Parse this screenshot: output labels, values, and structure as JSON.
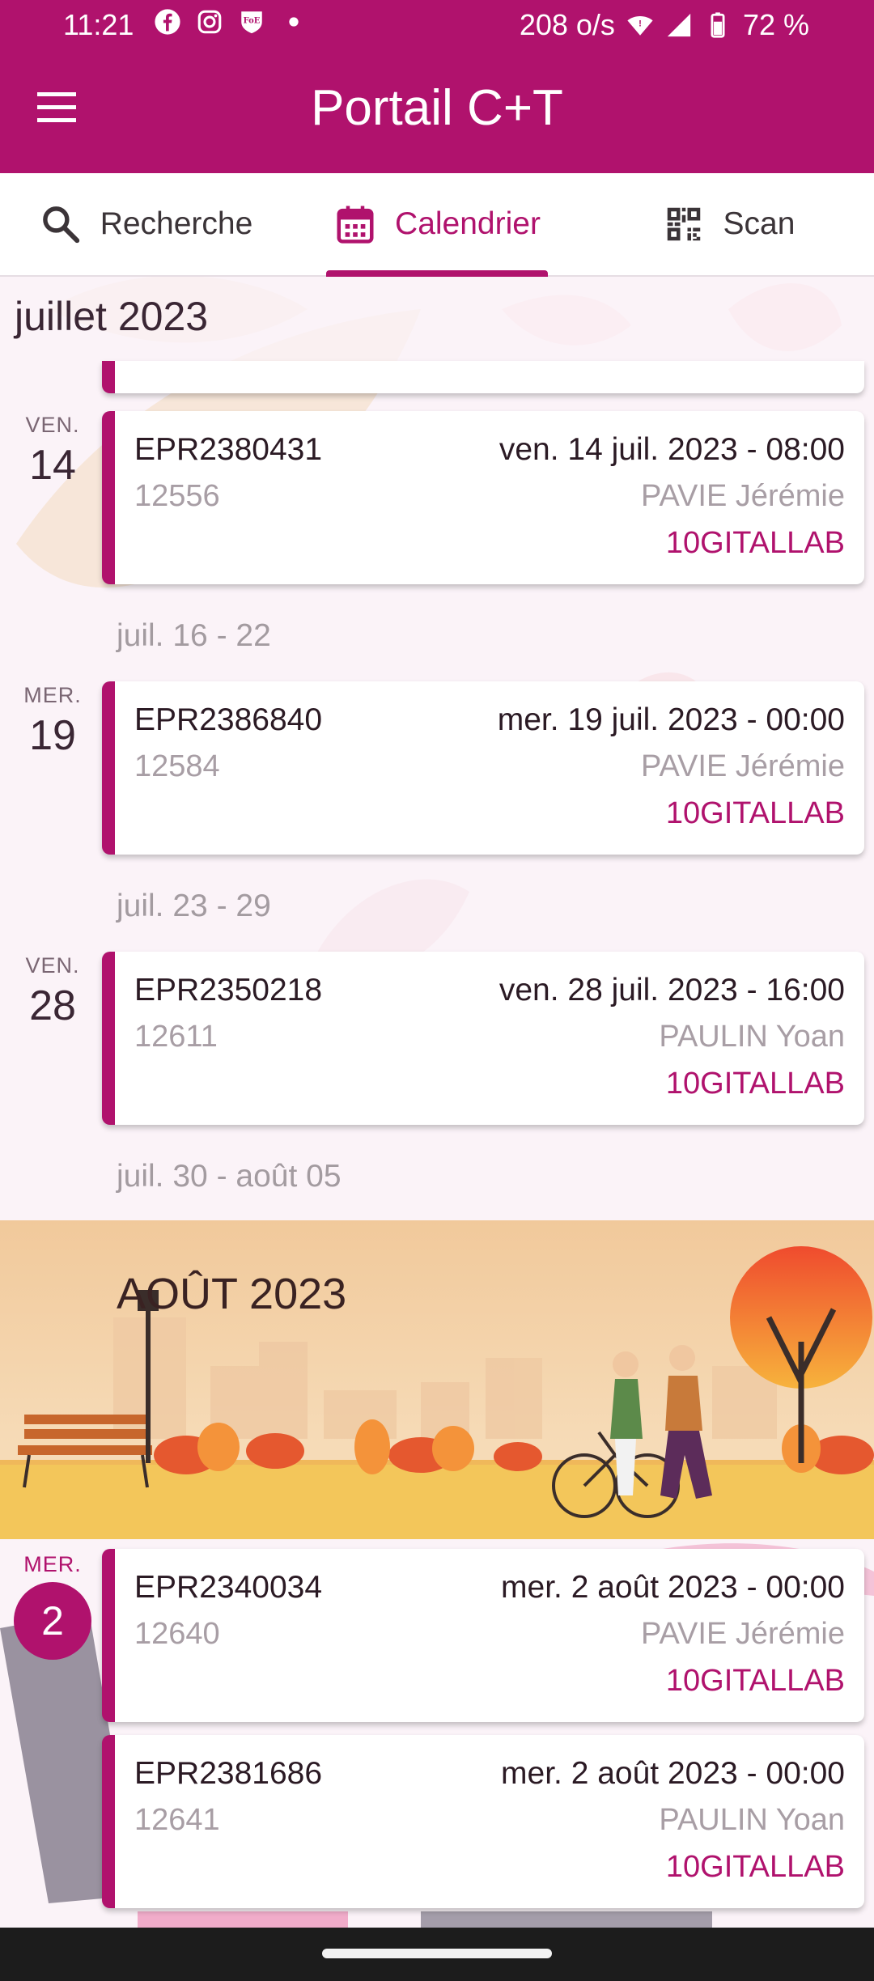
{
  "status_bar": {
    "time": "11:21",
    "speed": "208 o/s",
    "battery": "72 %",
    "icons": [
      "facebook-icon",
      "instagram-icon",
      "foe-shield-icon",
      "dot-icon",
      "wifi-icon",
      "signal-icon",
      "battery-icon"
    ]
  },
  "app": {
    "title": "Portail C+T"
  },
  "tabs": [
    {
      "label": "Recherche",
      "icon": "search-icon"
    },
    {
      "label": "Calendrier",
      "icon": "calendar-icon"
    },
    {
      "label": "Scan",
      "icon": "qr-code-icon"
    }
  ],
  "calendar": {
    "month_header": "juillet 2023",
    "days": [
      {
        "dow": "VEN.",
        "num": "14"
      },
      {
        "dow": "MER.",
        "num": "19"
      },
      {
        "dow": "VEN.",
        "num": "28"
      },
      {
        "dow": "MER.",
        "num": "2"
      }
    ],
    "weeks": [
      "juil. 16 - 22",
      "juil. 23 - 29",
      "juil. 30 - août 05"
    ],
    "events": [
      {
        "code": "EPR2380431",
        "datetime": "ven. 14 juil. 2023 - 08:00",
        "number": "12556",
        "person": "PAVIE Jérémie",
        "group": "10GITALLAB"
      },
      {
        "code": "EPR2386840",
        "datetime": "mer. 19 juil. 2023 - 00:00",
        "number": "12584",
        "person": "PAVIE Jérémie",
        "group": "10GITALLAB"
      },
      {
        "code": "EPR2350218",
        "datetime": "ven. 28 juil. 2023 - 16:00",
        "number": "12611",
        "person": "PAULIN Yoan",
        "group": "10GITALLAB"
      },
      {
        "code": "EPR2340034",
        "datetime": "mer. 2 août 2023 - 00:00",
        "number": "12640",
        "person": "PAVIE Jérémie",
        "group": "10GITALLAB"
      },
      {
        "code": "EPR2381686",
        "datetime": "mer. 2 août 2023 - 00:00",
        "number": "12641",
        "person": "PAULIN Yoan",
        "group": "10GITALLAB"
      }
    ],
    "banner": {
      "title": "AOÛT 2023",
      "illustration": "autumn-park-illustration"
    }
  },
  "colors": {
    "primary": "#b0126d",
    "background": "#fbf3f8"
  }
}
